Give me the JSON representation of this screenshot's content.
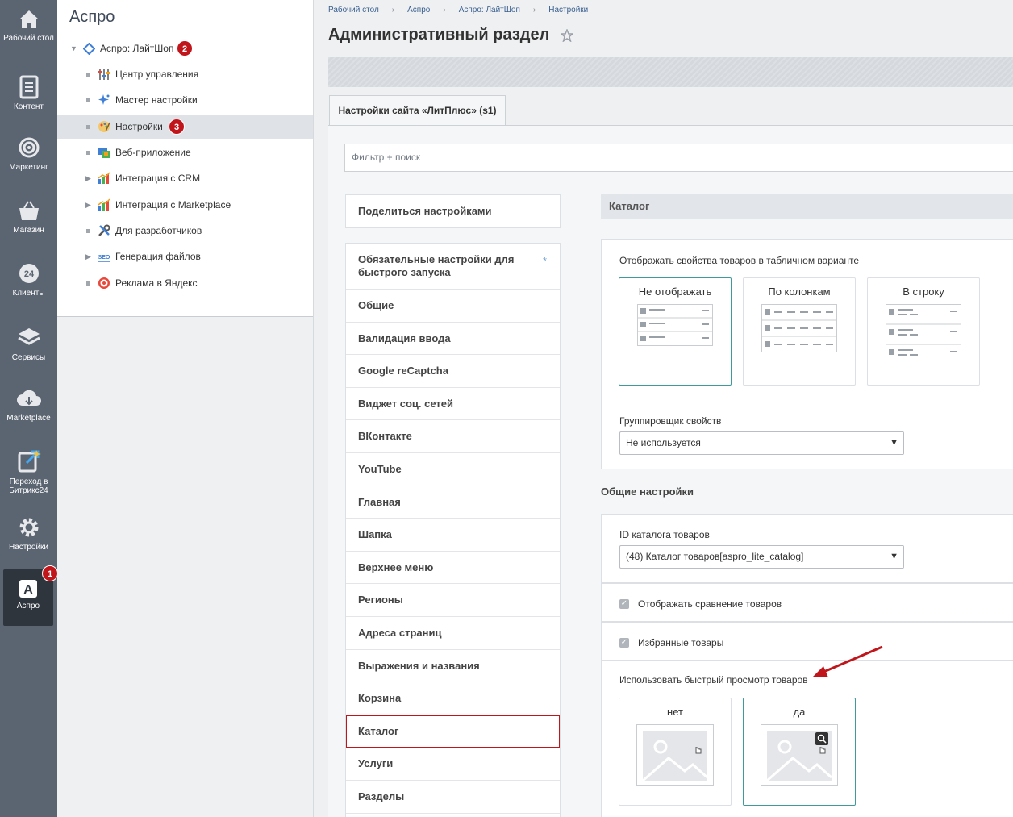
{
  "leftbar": {
    "items": [
      {
        "label": "Рабочий стол",
        "icon": "home-icon"
      },
      {
        "label": "Контент",
        "icon": "document-icon"
      },
      {
        "label": "Маркетинг",
        "icon": "target-icon"
      },
      {
        "label": "Магазин",
        "icon": "basket-icon"
      },
      {
        "label": "Клиенты",
        "icon": "clients-24-icon",
        "icon_text": "24"
      },
      {
        "label": "Сервисы",
        "icon": "layers-icon"
      },
      {
        "label": "Marketplace",
        "icon": "cloud-download-icon"
      },
      {
        "label": "Переход в Битрикс24",
        "icon": "external-link-icon"
      },
      {
        "label": "Настройки",
        "icon": "gear-icon"
      },
      {
        "label": "Аспро",
        "icon": "aspro-a-icon",
        "icon_text": "A"
      }
    ],
    "badge": "1"
  },
  "tree": {
    "title": "Аспро",
    "root": {
      "label": "Аспро: ЛайтШоп",
      "badge": "2"
    },
    "items": [
      {
        "label": "Центр управления",
        "expandable": false
      },
      {
        "label": "Мастер настройки",
        "expandable": false
      },
      {
        "label": "Настройки",
        "expandable": false,
        "selected": true,
        "badge": "3"
      },
      {
        "label": "Веб-приложение",
        "expandable": false
      },
      {
        "label": "Интеграция с CRM",
        "expandable": true
      },
      {
        "label": "Интеграция с Marketplace",
        "expandable": true
      },
      {
        "label": "Для разработчиков",
        "expandable": false
      },
      {
        "label": "Генерация файлов",
        "expandable": true
      },
      {
        "label": "Реклама в Яндекс",
        "expandable": false
      }
    ]
  },
  "breadcrumbs": [
    "Рабочий стол",
    "Аспро",
    "Аспро: ЛайтШоп",
    "Настройки"
  ],
  "page_title": "Административный раздел",
  "tab": "Настройки сайта «ЛитПлюс» (s1)",
  "filter_placeholder": "Фильтр + поиск",
  "share_button": "Поделиться настройками",
  "menu": {
    "required": "Обязательные настройки для быстрого запуска",
    "required_mark": "*",
    "items": [
      "Общие",
      "Валидация ввода",
      "Google reCaptcha",
      "Виджет соц. сетей",
      "ВКонтакте",
      "YouTube",
      "Главная",
      "Шапка",
      "Верхнее меню",
      "Регионы",
      "Адреса страниц",
      "Выражения и названия",
      "Корзина",
      "Каталог",
      "Услуги",
      "Разделы"
    ],
    "highlighted": "Каталог"
  },
  "catalog": {
    "heading": "Каталог",
    "props_label": "Отображать свойства товаров в табличном варианте",
    "props_options": [
      "Не отображать",
      "По колонкам",
      "В строку"
    ],
    "props_selected": "Не отображать",
    "grouper_label": "Группировщик свойств",
    "grouper_value": "Не используется"
  },
  "general": {
    "heading": "Общие настройки",
    "catalog_id_label": "ID каталога товаров",
    "catalog_id_value": "(48) Каталог товаров[aspro_lite_catalog]",
    "compare_label": "Отображать сравнение товаров",
    "compare_checked": true,
    "favorites_label": "Избранные товары",
    "favorites_checked": true,
    "quickview_label": "Использовать быстрый просмотр товаров",
    "quickview_options": [
      "нет",
      "да"
    ],
    "quickview_selected": "да"
  },
  "colors": {
    "accent_red": "#c0161b",
    "selected_teal": "#3f9b9b",
    "sidebar": "#5b6471"
  }
}
